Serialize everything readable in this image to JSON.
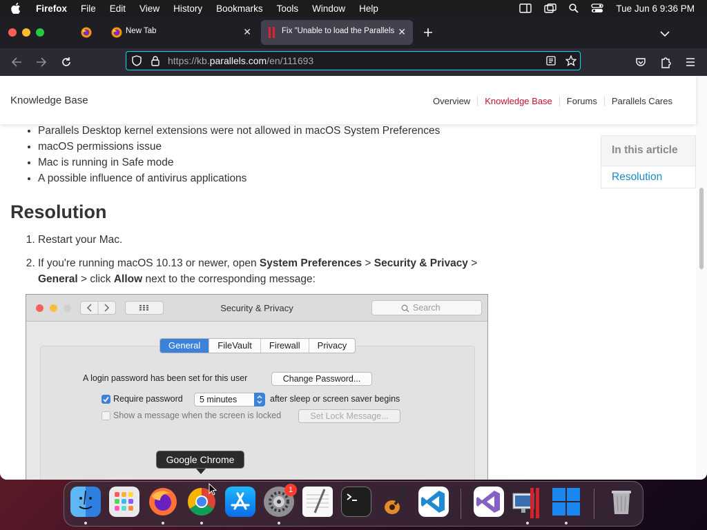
{
  "menubar": {
    "app": "Firefox",
    "items": [
      "File",
      "Edit",
      "View",
      "History",
      "Bookmarks",
      "Tools",
      "Window",
      "Help"
    ],
    "datetime": "Tue Jun 6  9:36 PM"
  },
  "browser": {
    "tabs": [
      {
        "label": ""
      },
      {
        "label": "New Tab"
      },
      {
        "label": "Fix \"Unable to load the Parallels"
      }
    ],
    "url": {
      "prefix": "https://kb.",
      "host": "parallels.com",
      "path": "/en/111693"
    }
  },
  "site": {
    "title": "Knowledge Base",
    "nav": [
      "Overview",
      "Knowledge Base",
      "Forums",
      "Parallels Cares"
    ]
  },
  "article": {
    "causes": [
      "Parallels Desktop kernel extensions were not allowed in macOS System Preferences",
      "macOS permissions issue",
      "Mac is running in Safe mode",
      "A possible influence of antivirus applications"
    ],
    "resolution_title": "Resolution",
    "step1": "Restart your Mac.",
    "step2": {
      "t1": "If you're running macOS 10.13 or newer, open ",
      "b1": "System Preferences",
      "t2": " > ",
      "b2": "Security & Privacy",
      "t3": " > ",
      "b3": "General",
      "t4": " > click ",
      "b4": "Allow",
      "t5": " next to the corresponding message:"
    }
  },
  "toc": {
    "heading": "In this article",
    "link": "Resolution"
  },
  "prefs": {
    "title": "Security & Privacy",
    "search_placeholder": "Search",
    "tabs": [
      "General",
      "FileVault",
      "Firewall",
      "Privacy"
    ],
    "login_text": "A login password has been set for this user",
    "change_password": "Change Password...",
    "require_password": "Require password",
    "delay": "5 minutes",
    "after_sleep": "after sleep or screen saver begins",
    "show_message": "Show a message when the screen is locked",
    "set_lock_message": "Set Lock Message..."
  },
  "dock": {
    "tooltip": "Google Chrome",
    "badge": "1",
    "icons": [
      "finder-icon",
      "launchpad-icon",
      "firefox-icon",
      "chrome-icon",
      "app-store-icon",
      "system-preferences-icon",
      "textedit-icon",
      "terminal-icon",
      "garageband-icon",
      "vscode-icon",
      "visual-studio-icon",
      "parallels-desktop-icon",
      "windows-icon",
      "trash-icon"
    ]
  },
  "colors": {
    "accent_link": "#1a8ac6",
    "site_active": "#c8102e",
    "url_focus": "#00ddff",
    "firefox_toolbar": "#2b2a33"
  }
}
